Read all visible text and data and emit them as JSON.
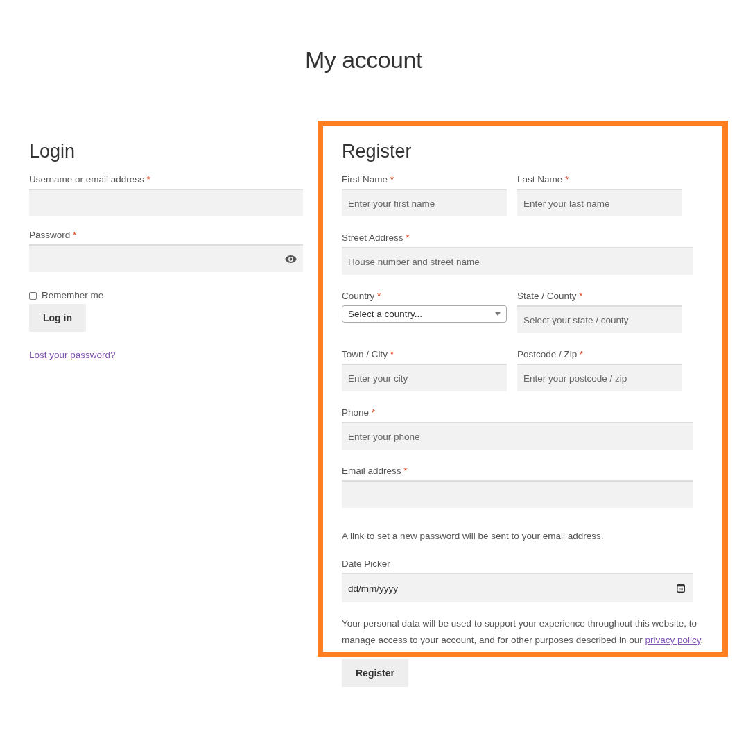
{
  "page_title": "My account",
  "login": {
    "title": "Login",
    "fields": [
      {
        "kind": "text",
        "label": "Username or email address",
        "marker": "*"
      },
      {
        "kind": "password",
        "label": "Password",
        "marker": "*"
      }
    ],
    "remember": {
      "label": "Remember me",
      "checked": false
    },
    "button": "Log in",
    "lost_link": "Lost your password?"
  },
  "register": {
    "title": "Register",
    "highlighted": true,
    "rows": [
      {
        "fields": [
          {
            "kind": "text",
            "label": "First Name",
            "marker": "*",
            "placeholder": "Enter your first name"
          },
          {
            "kind": "text",
            "label": "Last Name",
            "marker": "*",
            "placeholder": "Enter your last name"
          }
        ]
      },
      {
        "fields": [
          {
            "kind": "wide",
            "label": "Street Address",
            "marker": "*",
            "placeholder": "House number and street name"
          }
        ]
      },
      {
        "fields": [
          {
            "kind": "select",
            "label": "Country",
            "marker": "*",
            "value": "Select a country..."
          },
          {
            "kind": "text",
            "label": "State / County",
            "marker": "*",
            "placeholder": "Select your state / county"
          }
        ]
      },
      {
        "fields": [
          {
            "kind": "text",
            "label": "Town / City",
            "marker": "*",
            "placeholder": "Enter your city"
          },
          {
            "kind": "text",
            "label": "Postcode / Zip",
            "marker": "*",
            "placeholder": "Enter your postcode / zip"
          }
        ]
      },
      {
        "fields": [
          {
            "kind": "wide",
            "label": "Phone",
            "marker": "*",
            "placeholder": "Enter your phone"
          }
        ]
      },
      {
        "fields": [
          {
            "kind": "wide",
            "label": "Email address",
            "marker": "*"
          }
        ]
      }
    ],
    "note": "A link to set a new password will be sent to your email address.",
    "date": {
      "label": "Date Picker",
      "value": "dd/mm/yyyy"
    },
    "privacy_text": "Your personal data will be used to support your experience throughout this website, to manage access to your account, and for other purposes described in our",
    "privacy_link": "privacy policy",
    "privacy_end": ".",
    "button": "Register"
  }
}
